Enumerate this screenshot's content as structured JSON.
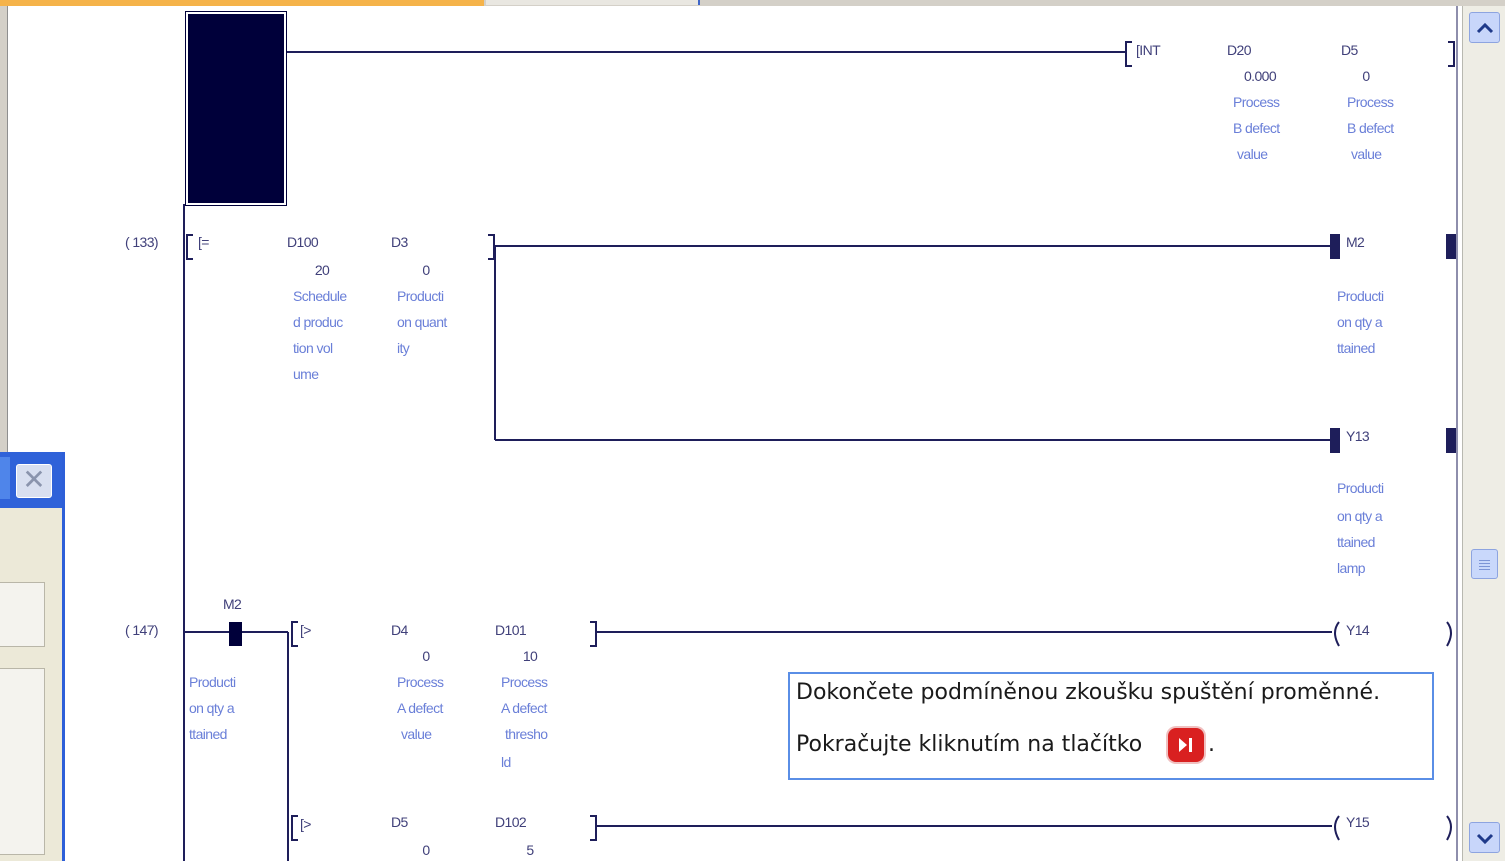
{
  "ladder": {
    "row0": {
      "instruction": "[INT",
      "arg1": {
        "device": "D20",
        "value": "0.000",
        "comment": [
          "Process",
          "B defect",
          "value"
        ]
      },
      "arg2": {
        "device": "D5",
        "value": "0",
        "comment": [
          "Process",
          "B defect",
          "value"
        ]
      }
    },
    "row1": {
      "step": "(   133)",
      "compare": "[=",
      "arg1": {
        "device": "D100",
        "value": "20",
        "comment": [
          "Schedule",
          "d produc",
          "tion vol",
          "ume"
        ]
      },
      "arg2": {
        "device": "D3",
        "value": "0",
        "comment": [
          "Producti",
          "on quant",
          "ity"
        ]
      },
      "coil1": {
        "device": "M2",
        "comment": [
          "Producti",
          "on qty a",
          "ttained"
        ]
      },
      "coil2": {
        "device": "Y13",
        "comment": [
          "Producti",
          "on qty a",
          "ttained",
          "lamp"
        ]
      }
    },
    "row2": {
      "step": "(   147)",
      "contact": {
        "device": "M2",
        "comment": [
          "Producti",
          "on qty a",
          "ttained"
        ]
      },
      "compare1": "[>",
      "arg1": {
        "device": "D4",
        "value": "0",
        "comment": [
          "Process",
          "A defect",
          "value"
        ]
      },
      "arg2": {
        "device": "D101",
        "value": "10",
        "comment": [
          "Process",
          "A defect",
          "thresho",
          "ld"
        ]
      },
      "coil1": {
        "device": "Y14"
      },
      "compare2": "[>",
      "arg3": {
        "device": "D5",
        "value": "0"
      },
      "arg4": {
        "device": "D102",
        "value": "5"
      },
      "coil2": {
        "device": "Y15"
      }
    }
  },
  "tooltip": {
    "line1": "Dokončete podmíněnou zkoušku spuštění proměnné.",
    "line2": "Pokračujte kliknutím na tlačítko",
    "line2_end": ".",
    "button_icon": "play-pause-icon"
  },
  "scrollbar": {
    "up_icon": "chevron-up-icon",
    "down_icon": "chevron-down-icon"
  },
  "dialog": {
    "close_icon": "close-icon"
  },
  "colors": {
    "wire": "#1e1e5a",
    "comment": "#6a7fd8",
    "device": "#40407a",
    "tooltip_border": "#5a8ee6",
    "play_button": "#d92020"
  }
}
